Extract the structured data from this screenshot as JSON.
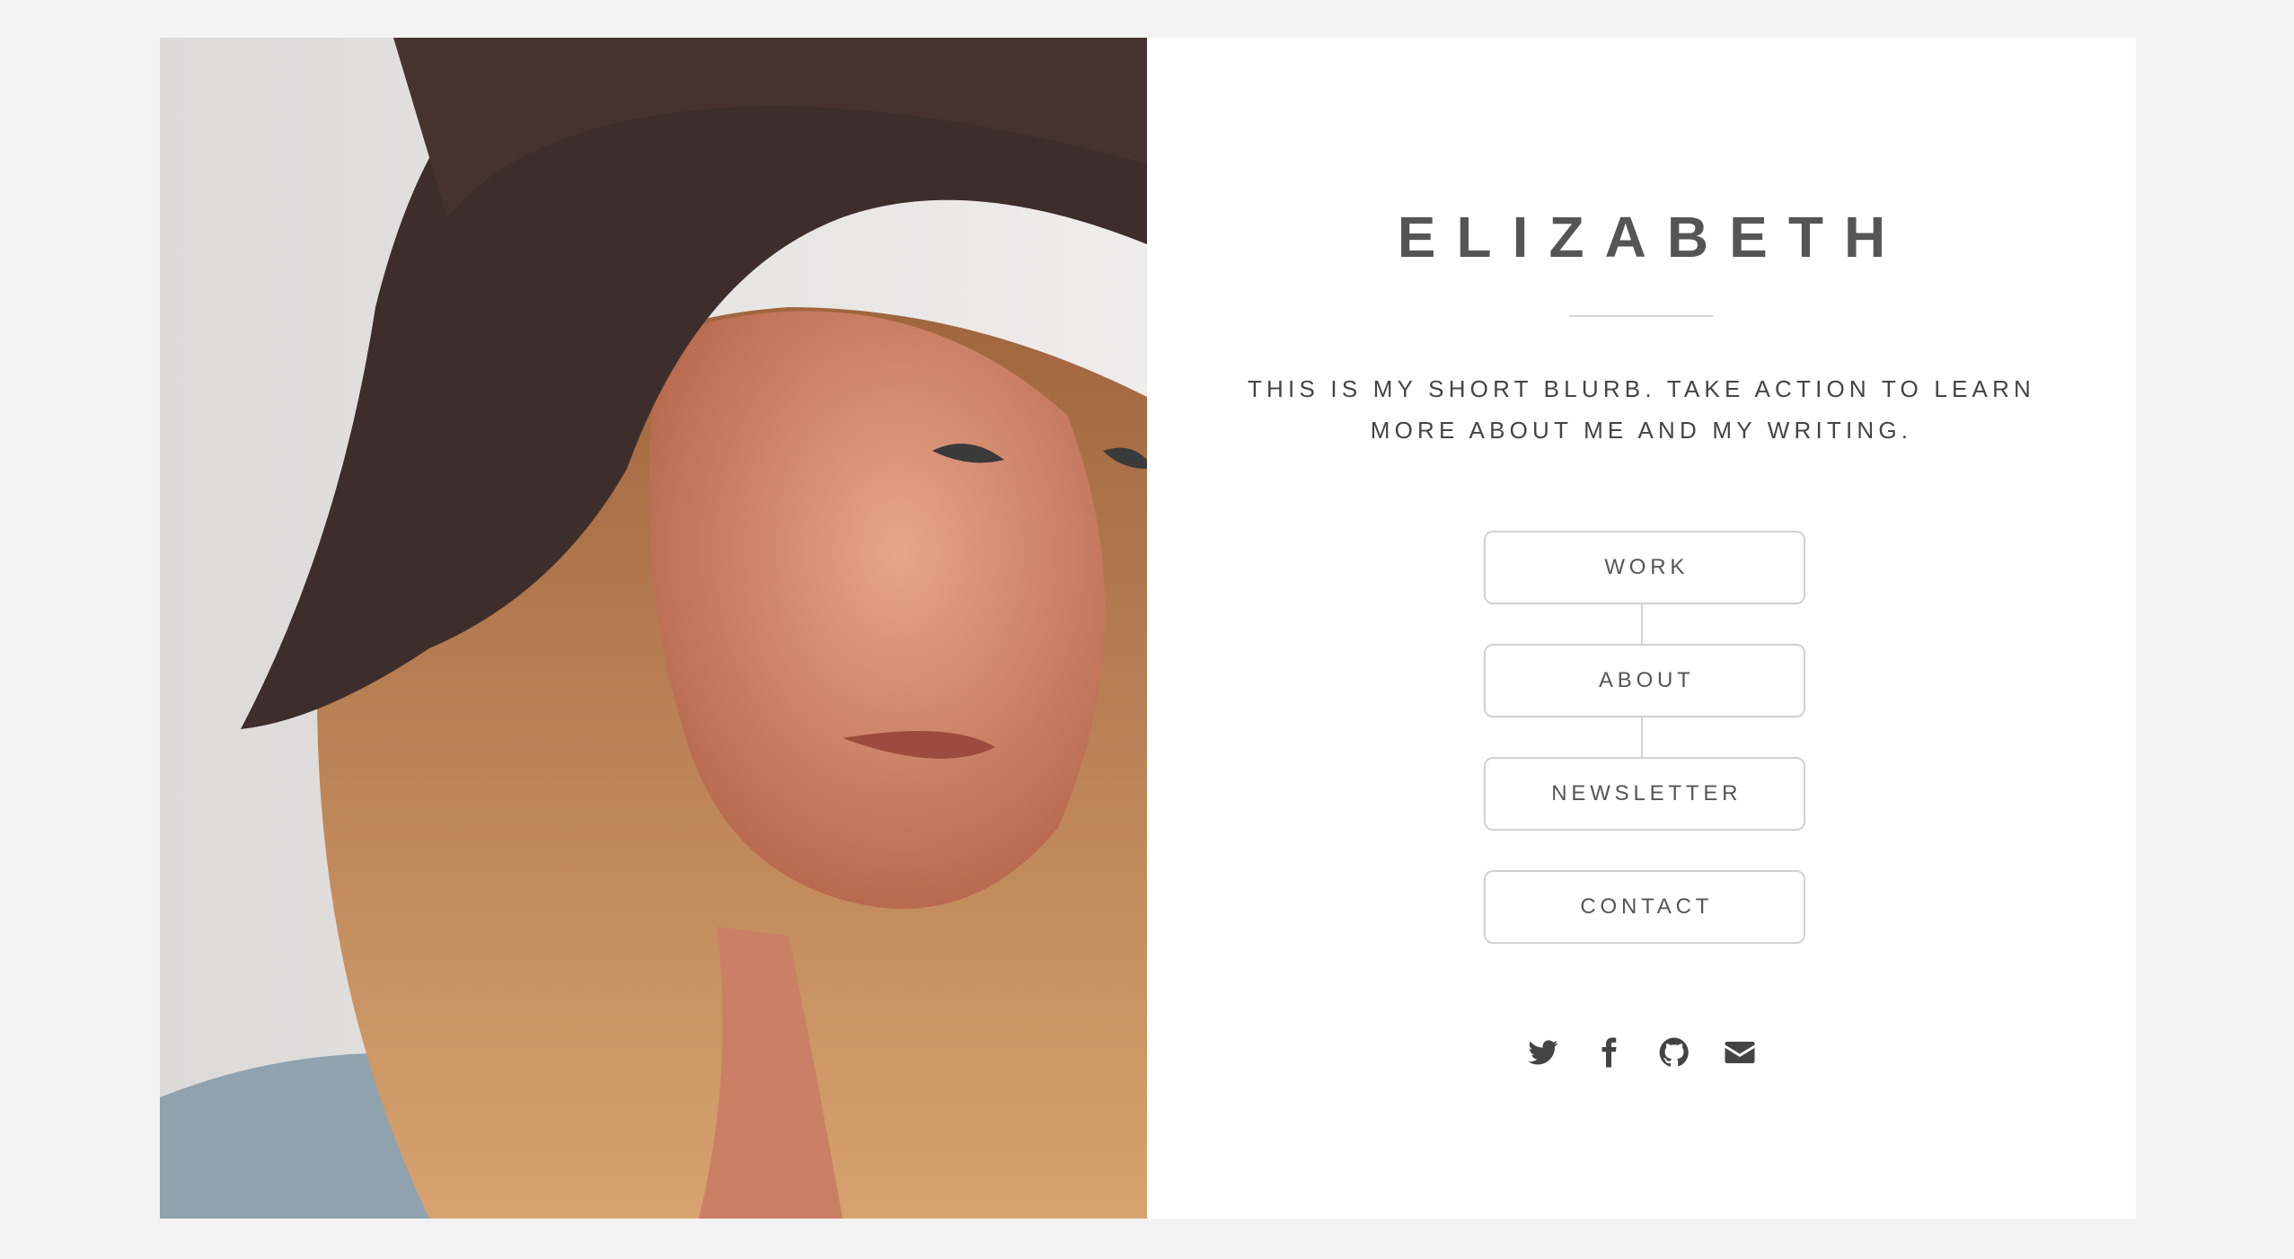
{
  "profile": {
    "name": "ELIZABETH",
    "blurb": "THIS IS MY SHORT BLURB. TAKE ACTION TO LEARN MORE ABOUT ME AND MY WRITING."
  },
  "nav": {
    "buttons": [
      {
        "label": "WORK"
      },
      {
        "label": "ABOUT"
      },
      {
        "label": "NEWSLETTER"
      },
      {
        "label": "CONTACT"
      }
    ]
  },
  "social": {
    "icons": [
      "twitter-icon",
      "facebook-icon",
      "github-icon",
      "email-icon"
    ]
  },
  "colors": {
    "background": "#f3f3f3",
    "card": "#ffffff",
    "text": "#555555",
    "border": "#d2d2d2"
  }
}
